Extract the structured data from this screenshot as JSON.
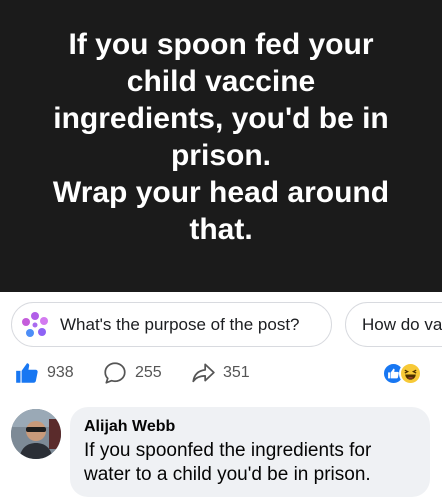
{
  "post": {
    "image_text": "If you spoon fed your\nchild vaccine\ningredients, you'd be in\nprison.\nWrap your head around\nthat."
  },
  "chips": [
    {
      "label": "What's the purpose of the post?",
      "icon": "ai-sparkle-icon"
    },
    {
      "label": "How do va",
      "icon": ""
    }
  ],
  "reactions": {
    "likes": "938",
    "comments": "255",
    "shares": "351",
    "reaction_icons": [
      "like-reaction-icon",
      "haha-reaction-icon"
    ],
    "colors": {
      "like": "#1877f2",
      "haha": "#f7c937"
    }
  },
  "comment": {
    "author": "Alijah Webb",
    "text": "If you spoonfed the ingredients for water to a child you'd be in prison."
  }
}
